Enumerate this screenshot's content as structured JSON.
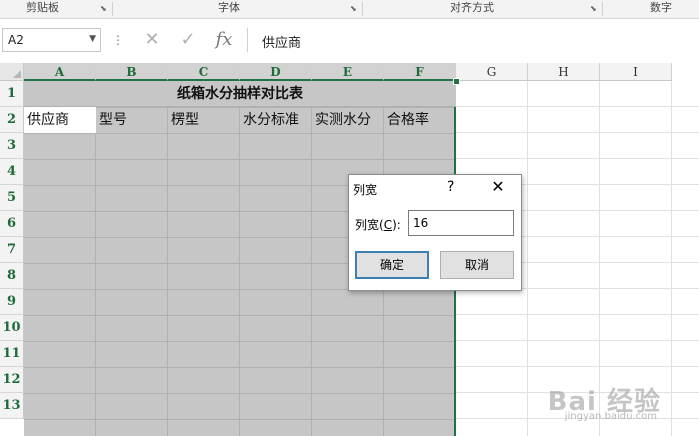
{
  "ribbon": {
    "groups": [
      {
        "label": "剪贴板"
      },
      {
        "label": "字体"
      },
      {
        "label": "对齐方式"
      },
      {
        "label": "数字"
      }
    ]
  },
  "formula_bar": {
    "name_box": "A2",
    "cancel_icon": "x-icon",
    "enter_icon": "check-icon",
    "fx_label": "fx",
    "content": "供应商"
  },
  "sheet": {
    "columns": [
      "A",
      "B",
      "C",
      "D",
      "E",
      "F",
      "G",
      "H",
      "I"
    ],
    "selected_columns": [
      "A",
      "B",
      "C",
      "D",
      "E",
      "F"
    ],
    "rows": [
      "1",
      "2",
      "3",
      "4",
      "5",
      "6",
      "7",
      "8",
      "9",
      "10",
      "11",
      "12",
      "13"
    ],
    "title": "纸箱水分抽样对比表",
    "headers": [
      "供应商",
      "型号",
      "楞型",
      "水分标准",
      "实测水分",
      "合格率"
    ],
    "active_cell": "A2",
    "selection_color": "#c6c6c6",
    "accent_color": "#217346"
  },
  "dialog": {
    "title": "列宽",
    "help": "?",
    "close": "✕",
    "field_label_prefix": "列宽(",
    "field_label_key": "C",
    "field_label_suffix": "):",
    "value": "16",
    "ok_label": "确定",
    "cancel_label": "取消"
  },
  "watermark": {
    "text": "Bai 经验",
    "url": "jingyan.baidu.com"
  }
}
